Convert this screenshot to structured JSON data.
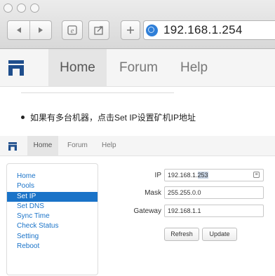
{
  "browser": {
    "address": "192.168.1.254",
    "nav": {
      "home": "Home",
      "forum": "Forum",
      "help": "Help"
    }
  },
  "instruction": "如果有多台机器，点击Set IP设置矿机IP地址",
  "app": {
    "nav": {
      "home": "Home",
      "forum": "Forum",
      "help": "Help"
    },
    "sidebar": {
      "items": [
        "Home",
        "Pools",
        "Set IP",
        "Set DNS",
        "Sync Time",
        "Check Status",
        "Setting",
        "Reboot"
      ],
      "active": "Set IP"
    },
    "form": {
      "ip_label": "IP",
      "ip_prefix": "192.168.1.",
      "ip_selected": "253",
      "mask_label": "Mask",
      "mask_value": "255.255.0.0",
      "gateway_label": "Gateway",
      "gateway_value": "192.168.1.1",
      "refresh_button": "Refresh",
      "update_button": "Update"
    }
  },
  "colors": {
    "link": "#1a73c8",
    "logo": "#1f4e8c",
    "selection": "#c7d3e3"
  },
  "icons": [
    "back-icon",
    "forward-icon",
    "reader-icon",
    "share-icon",
    "new-tab-icon",
    "globe-icon",
    "site-logo-icon",
    "autofill-icon"
  ]
}
